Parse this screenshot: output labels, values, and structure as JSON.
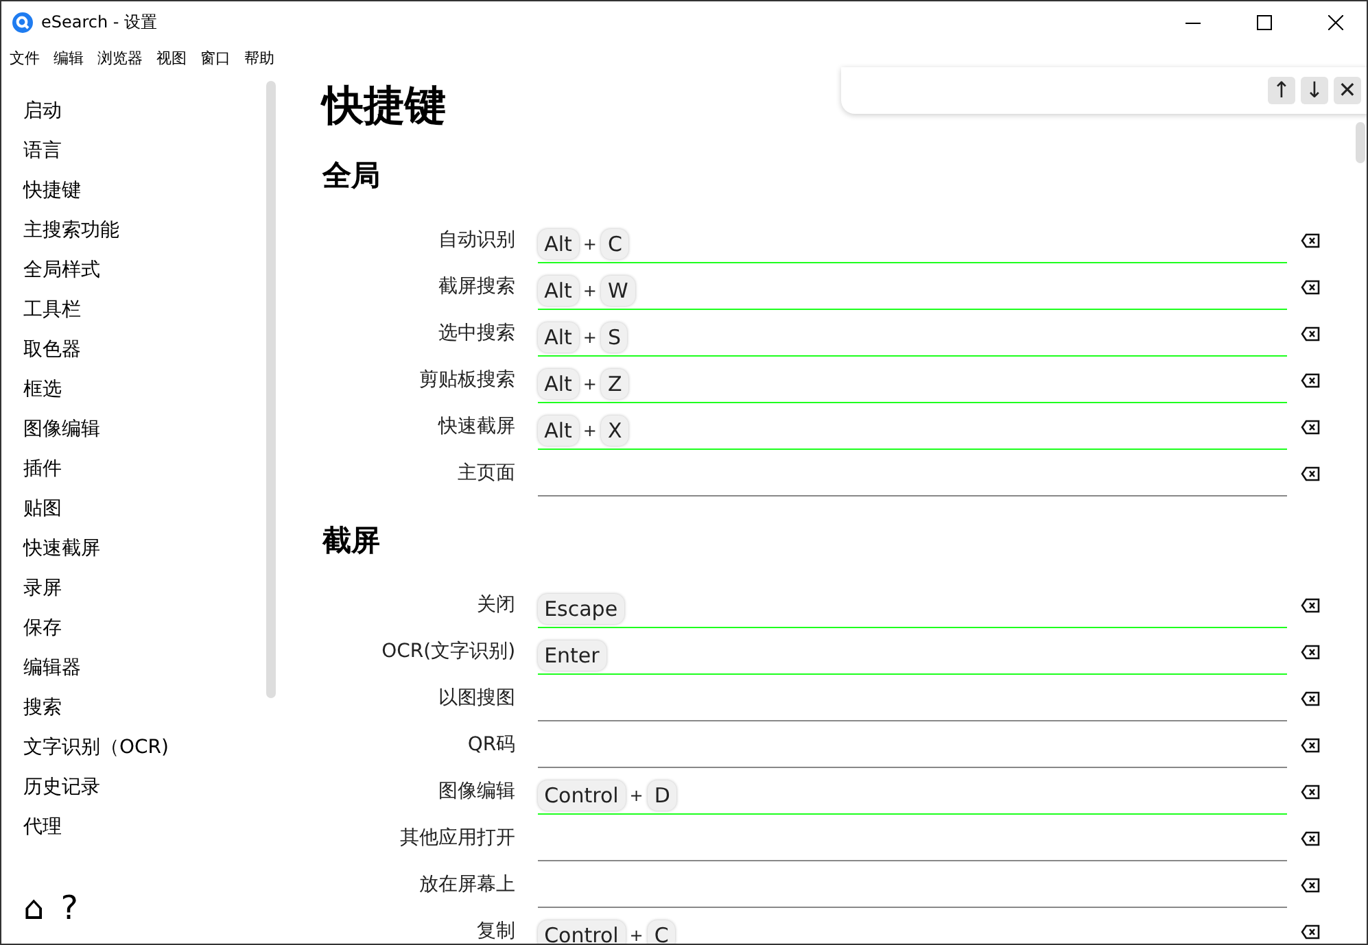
{
  "window": {
    "title": "eSearch - 设置"
  },
  "menu": [
    "文件",
    "编辑",
    "浏览器",
    "视图",
    "窗口",
    "帮助"
  ],
  "sidebar": {
    "items": [
      "启动",
      "语言",
      "快捷键",
      "主搜索功能",
      "全局样式",
      "工具栏",
      "取色器",
      "框选",
      "图像编辑",
      "插件",
      "贴图",
      "快速截屏",
      "录屏",
      "保存",
      "编辑器",
      "搜索",
      "文字识别（OCR)",
      "历史记录",
      "代理"
    ],
    "footer": [
      "⌂",
      "?"
    ]
  },
  "find_bar": {
    "buttons": [
      "↑",
      "↓",
      "✕"
    ]
  },
  "page": {
    "title": "快捷键",
    "sections": [
      {
        "title": "全局",
        "rows": [
          {
            "label": "自动识别",
            "keys": [
              "Alt",
              "C"
            ]
          },
          {
            "label": "截屏搜索",
            "keys": [
              "Alt",
              "W"
            ]
          },
          {
            "label": "选中搜索",
            "keys": [
              "Alt",
              "S"
            ]
          },
          {
            "label": "剪贴板搜索",
            "keys": [
              "Alt",
              "Z"
            ]
          },
          {
            "label": "快速截屏",
            "keys": [
              "Alt",
              "X"
            ]
          },
          {
            "label": "主页面",
            "keys": []
          }
        ]
      },
      {
        "title": "截屏",
        "rows": [
          {
            "label": "关闭",
            "keys": [
              "Escape"
            ]
          },
          {
            "label": "OCR(文字识别)",
            "keys": [
              "Enter"
            ]
          },
          {
            "label": "以图搜图",
            "keys": []
          },
          {
            "label": "QR码",
            "keys": []
          },
          {
            "label": "图像编辑",
            "keys": [
              "Control",
              "D"
            ]
          },
          {
            "label": "其他应用打开",
            "keys": []
          },
          {
            "label": "放在屏幕上",
            "keys": []
          },
          {
            "label": "复制",
            "keys": [
              "Control",
              "C"
            ]
          }
        ]
      }
    ]
  },
  "key_separator": "+"
}
